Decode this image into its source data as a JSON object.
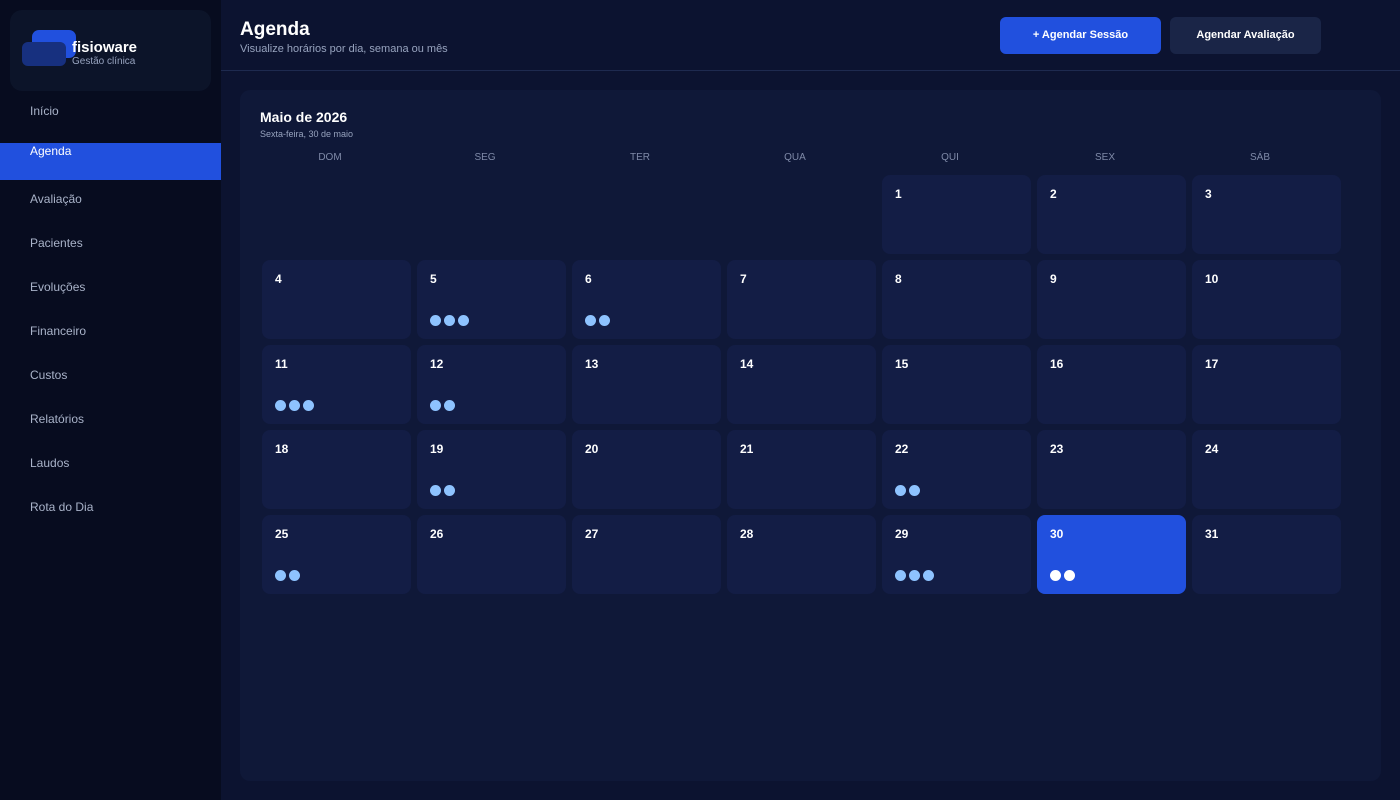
{
  "brand": {
    "name": "fisioware",
    "subtitle": "Gestão clínica"
  },
  "nav": [
    {
      "label": "Início",
      "active": false
    },
    {
      "label": "Agenda",
      "active": true
    },
    {
      "label": "Avaliação",
      "active": false
    },
    {
      "label": "Pacientes",
      "active": false
    },
    {
      "label": "Evoluções",
      "active": false
    },
    {
      "label": "Financeiro",
      "active": false
    },
    {
      "label": "Custos",
      "active": false
    },
    {
      "label": "Relatórios",
      "active": false
    },
    {
      "label": "Laudos",
      "active": false
    },
    {
      "label": "Rota do Dia",
      "active": false
    }
  ],
  "header": {
    "title": "Agenda",
    "subtitle": "Visualize horários por dia, semana ou mês",
    "primary_button": "+ Agendar Sessão",
    "secondary_button": "Agendar Avaliação"
  },
  "calendar": {
    "month_label": "Maio de 2026",
    "selected_date_label": "Sexta-feira, 30 de maio",
    "weekdays": [
      "DOM",
      "SEG",
      "TER",
      "QUA",
      "QUI",
      "SEX",
      "SÁB"
    ],
    "first_weekday_index": 4,
    "days_in_month": 31,
    "selected_day": 30,
    "appointment_counts": {
      "5": 3,
      "6": 2,
      "11": 3,
      "12": 2,
      "19": 2,
      "22": 2,
      "25": 2,
      "29": 3,
      "30": 2
    }
  },
  "colors": {
    "accent": "#2150de",
    "dot": "#8ec3ff",
    "cell": "#131d45",
    "panel": "#0f1838"
  }
}
